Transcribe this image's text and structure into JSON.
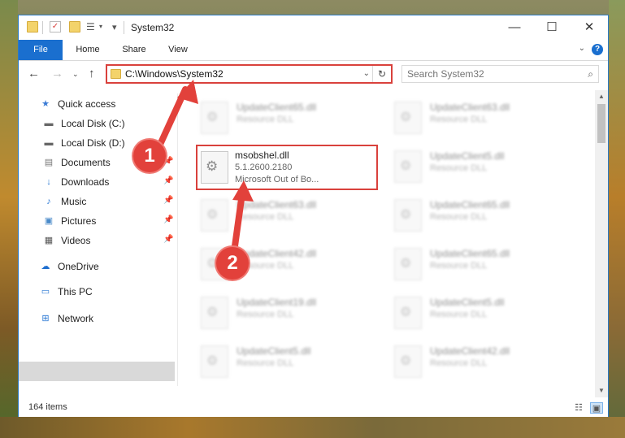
{
  "window": {
    "title": "System32"
  },
  "ribbon": {
    "tabs": [
      "File",
      "Home",
      "Share",
      "View"
    ]
  },
  "nav": {
    "address": "C:\\Windows\\System32",
    "search_placeholder": "Search System32"
  },
  "sidebar": {
    "items": [
      {
        "label": "Quick access",
        "icon": "star-icon"
      },
      {
        "label": "Local Disk (C:)",
        "icon": "drive-icon"
      },
      {
        "label": "Local Disk (D:)",
        "icon": "drive-icon"
      },
      {
        "label": "Documents",
        "icon": "documents-icon"
      },
      {
        "label": "Downloads",
        "icon": "download-icon"
      },
      {
        "label": "Music",
        "icon": "music-icon"
      },
      {
        "label": "Pictures",
        "icon": "pictures-icon"
      },
      {
        "label": "Videos",
        "icon": "videos-icon"
      },
      {
        "label": "OneDrive",
        "icon": "cloud-icon"
      },
      {
        "label": "This PC",
        "icon": "computer-icon"
      },
      {
        "label": "Network",
        "icon": "network-icon"
      }
    ]
  },
  "files": {
    "highlight": {
      "name": "msobshel.dll",
      "version": "5.1.2600.2180",
      "description": "Microsoft Out of Bo..."
    },
    "left": [
      {
        "name": "UpdateClient65.dll",
        "type": "Resource DLL"
      },
      {
        "name": "UpdateClient63.dll",
        "type": "Resource DLL"
      },
      {
        "name": "UpdateClient42.dll",
        "type": "Resource DLL"
      },
      {
        "name": "UpdateClient19.dll",
        "type": "Resource DLL"
      },
      {
        "name": "UpdateClient5.dll",
        "type": "Resource DLL"
      }
    ],
    "right": [
      {
        "name": "UpdateClient63.dll",
        "type": "Resource DLL"
      },
      {
        "name": "UpdateClient5.dll",
        "type": "Resource DLL"
      },
      {
        "name": "UpdateClient65.dll",
        "type": "Resource DLL"
      },
      {
        "name": "UpdateClient65.dll",
        "type": "Resource DLL"
      },
      {
        "name": "UpdateClient5.dll",
        "type": "Resource DLL"
      },
      {
        "name": "UpdateClient42.dll",
        "type": "Resource DLL"
      }
    ]
  },
  "status": {
    "items": "164 items"
  },
  "callouts": [
    "1",
    "2"
  ]
}
